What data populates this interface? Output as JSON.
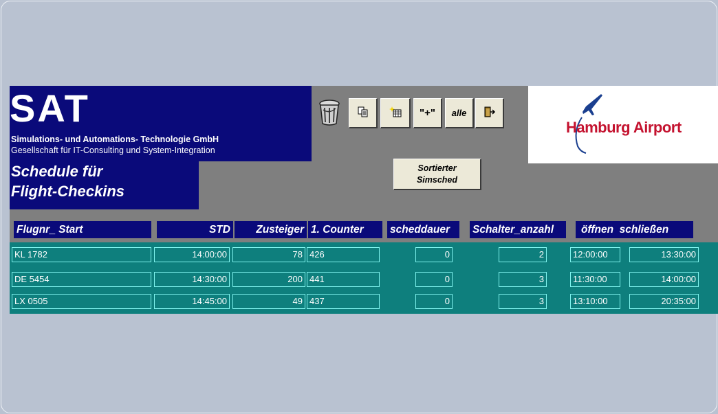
{
  "brand": {
    "logo": "SAT",
    "line1": "Simulations- und Automations- Technologie GmbH",
    "line2": "Gesellschaft für IT-Consulting und System-Integration"
  },
  "title": {
    "line1": "Schedule für",
    "line2": "Flight-Checkins"
  },
  "toolbar": {
    "trash_icon": "trash-icon",
    "copy_icon": "copy-icon",
    "new_icon": "new-table-icon",
    "plus_label": "\"+\"",
    "alle_label": "alle",
    "exit_icon": "exit-door-icon"
  },
  "airport": {
    "name": "Hamburg Airport"
  },
  "sort_button": {
    "line1": "Sortierter",
    "line2": "Simsched"
  },
  "columns": {
    "flugnr": "Flugnr_ Start",
    "std": "STD",
    "zusteiger": "Zusteiger",
    "counter": "1. Counter",
    "scheddauer": "scheddauer",
    "schalter": "Schalter_anzahl",
    "oeffnen_schliessen": "öffnen  schließen"
  },
  "rows": [
    {
      "flugnr": "KL 1782",
      "std": "14:00:00",
      "zusteiger": "78",
      "counter": "426",
      "scheddauer": "0",
      "schalter": "2",
      "oeffnen": "12:00:00",
      "schliessen": "13:30:00"
    },
    {
      "flugnr": "DE 5454",
      "std": "14:30:00",
      "zusteiger": "200",
      "counter": "441",
      "scheddauer": "0",
      "schalter": "3",
      "oeffnen": "11:30:00",
      "schliessen": "14:00:00"
    },
    {
      "flugnr": "LX 0505",
      "std": "14:45:00",
      "zusteiger": "49",
      "counter": "437",
      "scheddauer": "0",
      "schalter": "3",
      "oeffnen": "13:10:00",
      "schliessen": "20:35:00"
    }
  ],
  "colors": {
    "background": "#b9c2d1",
    "panel": "#7f7f7f",
    "navy": "#0a0a7a",
    "grid_teal": "#0e7f7d",
    "cell_border": "#7ff3ee",
    "airport_red": "#c4122f"
  }
}
